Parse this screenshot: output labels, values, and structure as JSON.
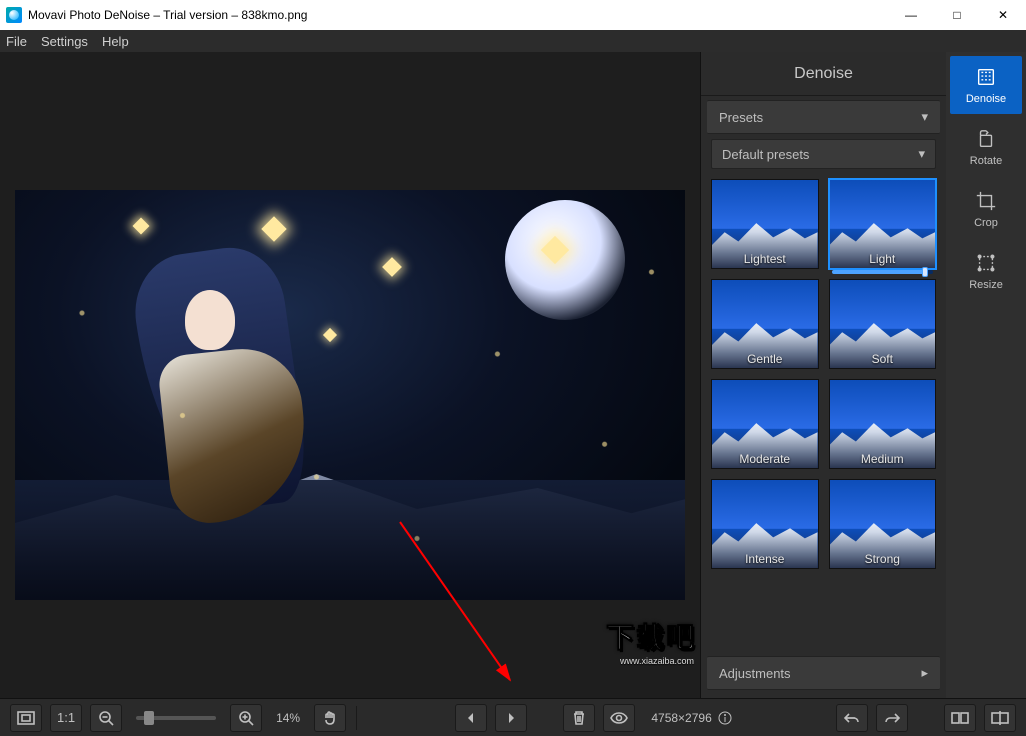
{
  "window": {
    "title": "Movavi Photo DeNoise – Trial version – 838kmo.png"
  },
  "menu": {
    "file": "File",
    "settings": "Settings",
    "help": "Help"
  },
  "panel": {
    "title": "Denoise",
    "presets_header": "Presets",
    "presets_dropdown": "Default presets",
    "adjustments_header": "Adjustments",
    "presets": [
      {
        "label": "Lightest",
        "selected": false
      },
      {
        "label": "Light",
        "selected": true
      },
      {
        "label": "Gentle",
        "selected": false
      },
      {
        "label": "Soft",
        "selected": false
      },
      {
        "label": "Moderate",
        "selected": false
      },
      {
        "label": "Medium",
        "selected": false
      },
      {
        "label": "Intense",
        "selected": false
      },
      {
        "label": "Strong",
        "selected": false
      }
    ]
  },
  "tools": {
    "denoise": "Denoise",
    "rotate": "Rotate",
    "crop": "Crop",
    "resize": "Resize"
  },
  "bottom": {
    "one_to_one": "1:1",
    "zoom_percent": "14%",
    "dimensions": "4758×2796"
  },
  "watermark": {
    "text": "下载吧",
    "url": "www.xiazaiba.com"
  }
}
